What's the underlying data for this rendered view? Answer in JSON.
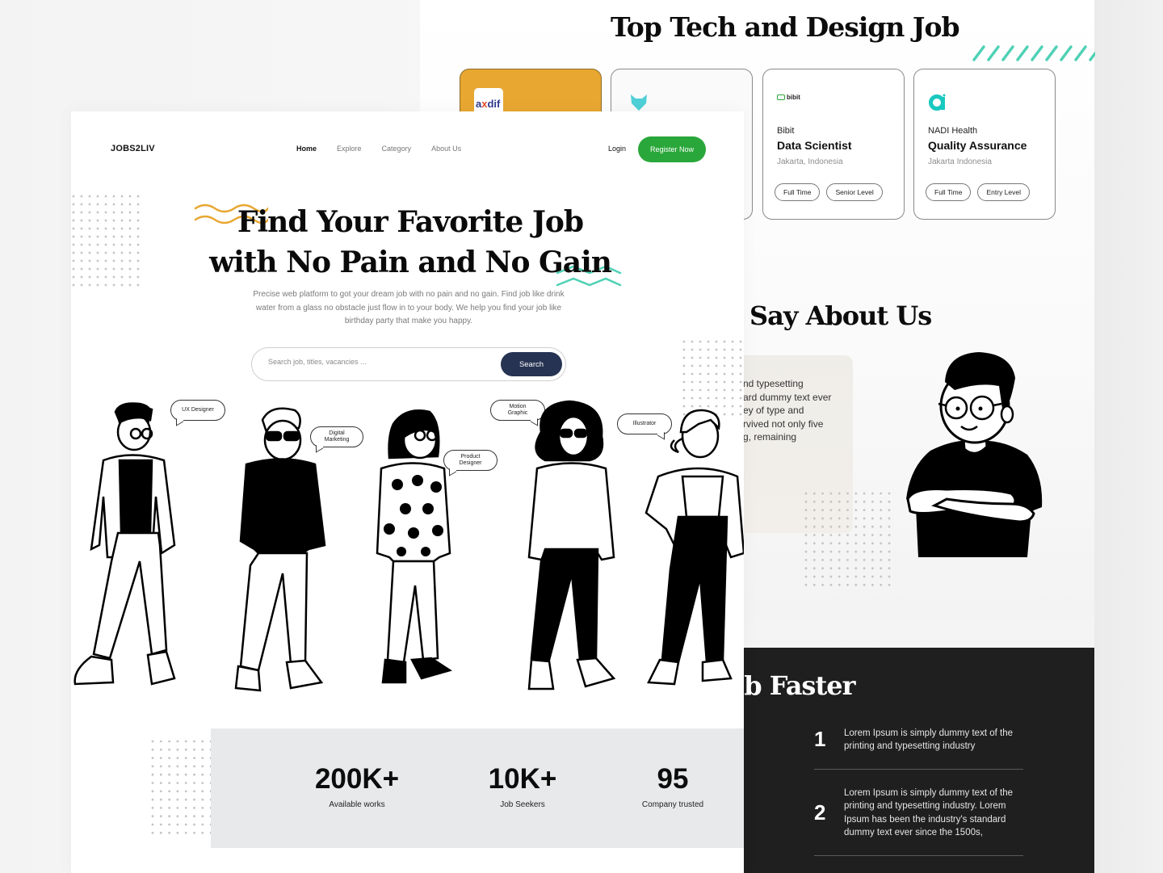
{
  "back_page": {
    "jobs_section_title": "Top Tech and Design Job",
    "job_cards": [
      {
        "logo": "axdif",
        "company": "",
        "role": "",
        "location": "",
        "tags": [],
        "accent": "#e8a731"
      },
      {
        "logo": "fox-logo",
        "company": "",
        "role": "",
        "location": "",
        "tags": []
      },
      {
        "logo": "bibit",
        "company": "Bibit",
        "role": "Data Scientist",
        "location": "Jakarta, Indonesia",
        "tags": [
          "Full Time",
          "Senior Level"
        ]
      },
      {
        "logo": "nadi-health",
        "company": "NADI Health",
        "role": "Quality Assurance",
        "location": "Jakarta Indonesia",
        "tags": [
          "Full Time",
          "Entry Level"
        ]
      }
    ],
    "axdif_logo": {
      "a": "a",
      "x": "x",
      "rest": "dif"
    },
    "bibit_logo_text": "bibit",
    "testimonial_title": "Say About Us",
    "testimonial_text": "nd typesetting\nard dummy text ever\ney of type and\nrvived not only five\ng, remaining",
    "steps_title": "ting Job Faster",
    "steps": [
      {
        "number": "1",
        "text": "Lorem Ipsum is simply dummy text of the printing and typesetting industry"
      },
      {
        "number": "2",
        "text": "Lorem Ipsum is simply dummy text of the printing and typesetting industry. Lorem Ipsum has been the industry's standard dummy text ever since the 1500s,"
      }
    ]
  },
  "front_page": {
    "brand": "JOBS2LIV",
    "nav": [
      {
        "label": "Home",
        "active": true
      },
      {
        "label": "Explore",
        "active": false
      },
      {
        "label": "Category",
        "active": false
      },
      {
        "label": "About Us",
        "active": false
      }
    ],
    "login_label": "Login",
    "register_label": "Register Now",
    "hero": {
      "title_line1": "Find Your Favorite Job",
      "title_line2": "with No Pain and No Gain",
      "subtitle": "Precise web platform to got your dream job with no pain and no gain. Find job like drink water from a glass no obstacle just flow in to your body. We help you find your job like birthday party that make you happy."
    },
    "search": {
      "placeholder": "Search job, titles, vacancies ...",
      "value": "",
      "button_label": "Search"
    },
    "roles": [
      {
        "label": "UX Designer"
      },
      {
        "label": "Digital Marketing"
      },
      {
        "label": "Product Designer"
      },
      {
        "label": "Motion Graphic"
      },
      {
        "label": "Illustrator"
      }
    ],
    "stats": [
      {
        "value": "200K+",
        "label": "Available works"
      },
      {
        "value": "10K+",
        "label": "Job Seekers"
      },
      {
        "value": "95",
        "label": "Company trusted"
      }
    ]
  },
  "colors": {
    "primary_green": "#2aa73a",
    "search_navy": "#263352",
    "accent_yellow": "#e8a731",
    "accent_teal": "#4fd1b5",
    "dark_section": "#1f1f1f"
  }
}
